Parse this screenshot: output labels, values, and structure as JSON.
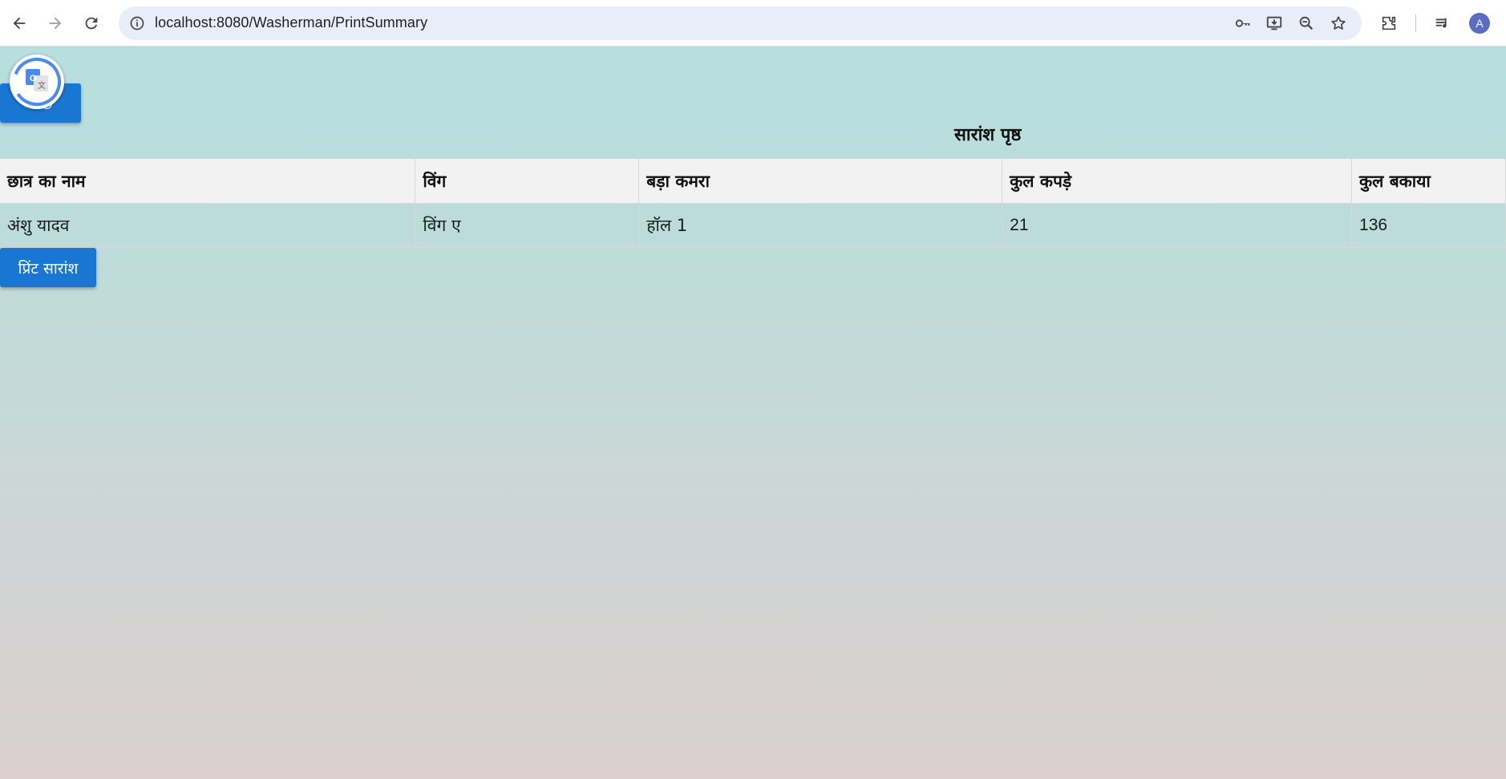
{
  "browser": {
    "url": "localhost:8080/Washerman/PrintSummary",
    "profile_initial": "A"
  },
  "page": {
    "back_label": "पीछे",
    "title": "सारांश पृष्ठ",
    "print_label": "प्रिंट सारांश"
  },
  "table": {
    "headers": [
      "छात्र का नाम",
      "विंग",
      "बड़ा कमरा",
      "कुल कपड़े",
      "कुल बकाया"
    ],
    "rows": [
      [
        "अंशु यादव",
        "विंग ए",
        "हॉल 1",
        "21",
        "136"
      ]
    ]
  },
  "colors": {
    "primary_button": "#1976d2",
    "page_gradient_top": "#b6dfde",
    "page_gradient_bottom": "#dbcfcf",
    "table_header_bg": "#f2f2f2"
  },
  "icons": {
    "toolbar": [
      "back-icon",
      "forward-icon",
      "reload-icon",
      "site-info-icon",
      "password-key-icon",
      "install-app-icon",
      "zoom-icon",
      "bookmark-star-icon",
      "extensions-icon",
      "media-controls-icon",
      "profile-avatar"
    ],
    "overlay": "google-translate-icon"
  }
}
